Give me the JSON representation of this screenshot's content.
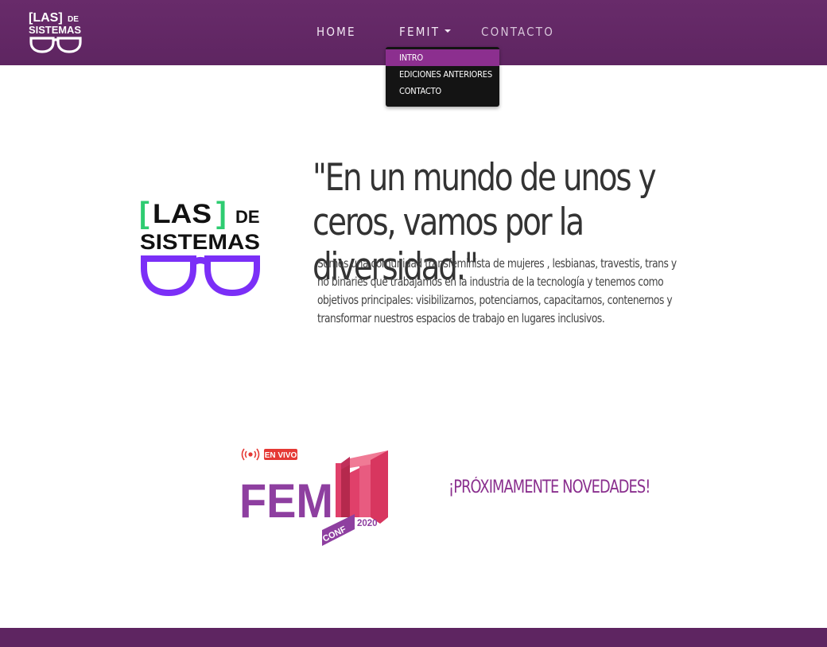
{
  "brand": {
    "logo_line1": "[LAS]",
    "logo_de": "DE",
    "logo_line2": "SISTEMAS"
  },
  "nav": {
    "home": "HOME",
    "femit": "FEMIT",
    "contacto": "CONTACTO"
  },
  "dropdown": {
    "items": [
      "INTRO",
      "EDICIONES ANTERIORES",
      "CONTACTO"
    ]
  },
  "hero": {
    "logo_open_bracket": "[",
    "logo_las": "LAS",
    "logo_close_bracket": "]",
    "logo_de": "DE",
    "logo_sistemas": "SISTEMAS",
    "quote": "\"En un mundo de unos y ceros, vamos por la diversidad.\"",
    "description": "Somos una comunidad transfeminista de mujeres , lesbianas, travestis, trans y no binaries que trabajamos en la industria de la tecnología y tenemos como objetivos principales: visibilizarnos, potenciarnos, capacitarnos, contenernos y transformar nuestros espacios de trabajo en lugares inclusivos."
  },
  "femit": {
    "live_badge": "EN VIVO",
    "live_icon": "broadcast-icon",
    "logo_fem": "FEM",
    "logo_it": "IT",
    "logo_conf": "CONF",
    "logo_year": "2020",
    "announcement": "¡PRÓXIMAMENTE NOVEDADES!"
  },
  "colors": {
    "nav_bg": "#632866",
    "accent_purple": "#8a2f8e",
    "dropdown_active": "#8c2f8f",
    "logo_green": "#2ecc71",
    "glasses_purple": "#7b2ff7",
    "femit_pink": "#e0406a",
    "femit_purple": "#8e3fa0",
    "live_red": "#e53935"
  }
}
